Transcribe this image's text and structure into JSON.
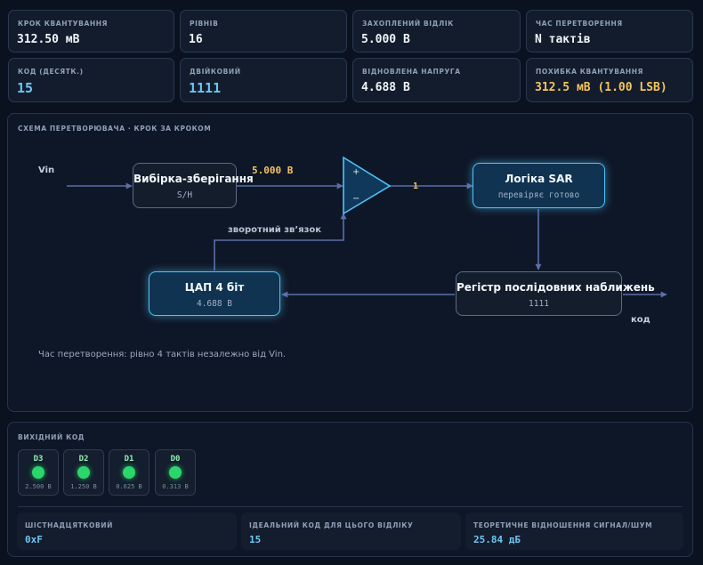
{
  "stats_row1": [
    {
      "label": "КРОК КВАНТУВАННЯ",
      "value": "312.50 мВ"
    },
    {
      "label": "РІВНІВ",
      "value": "16"
    },
    {
      "label": "ЗАХОПЛЕНИЙ ВІДЛІК",
      "value": "5.000 В"
    },
    {
      "label": "ЧАС ПЕРЕТВОРЕННЯ",
      "value": "N тактів"
    }
  ],
  "stats_row2": [
    {
      "label": "КОД (ДЕСЯТК.)",
      "value": "15"
    },
    {
      "label": "ДВІЙКОВИЙ",
      "value": "1111"
    },
    {
      "label": "ВІДНОВЛЕНА НАПРУГА",
      "value": "4.688 В"
    },
    {
      "label": "ПОХИБКА КВАНТУВАННЯ",
      "value": "312.5 мВ (1.00 LSB)"
    }
  ],
  "diagram": {
    "title": "СХЕМА ПЕРЕТВОРЮВАЧА · КРОК ЗА КРОКОМ",
    "vin_label": "Vin",
    "sample_hold": {
      "title": "Вибірка-зберігання",
      "sub": "S/H"
    },
    "sample_value": "5.000 В",
    "comparator": {
      "plus": "+",
      "minus": "−",
      "output": "1"
    },
    "sar_logic": {
      "title": "Логіка SAR",
      "sub": "перевіряє готово"
    },
    "feedback_label": "зворотний зв’язок",
    "dac": {
      "title": "ЦАП 4 біт",
      "sub": "4.688 В"
    },
    "register": {
      "title": "Регістр послідовних наближень",
      "sub": "1111"
    },
    "code_label": "код",
    "note": "Час перетворення: рівно 4 тактів незалежно від Vin."
  },
  "output": {
    "title": "ВИХІДНИЙ КОД",
    "bits": [
      {
        "name": "D3",
        "weight": "2.500 В"
      },
      {
        "name": "D2",
        "weight": "1.250 В"
      },
      {
        "name": "D1",
        "weight": "0.625 В"
      },
      {
        "name": "D0",
        "weight": "0.313 В"
      }
    ],
    "summary": [
      {
        "label": "ШІСТНАДЦЯТКОВИЙ",
        "value": "0xF"
      },
      {
        "label": "ІДЕАЛЬНИЙ КОД ДЛЯ ЦЬОГО ВІДЛІКУ",
        "value": "15"
      },
      {
        "label": "ТЕОРЕТИЧНЕ ВІДНОШЕННЯ СИГНАЛ/ШУМ",
        "value": "25.84 дБ"
      }
    ]
  },
  "colors": {
    "accent": "#4fc3f7",
    "highlight": "#f5c45e",
    "code_blue": "#6ec6f5",
    "led_on": "#2bd66a"
  }
}
